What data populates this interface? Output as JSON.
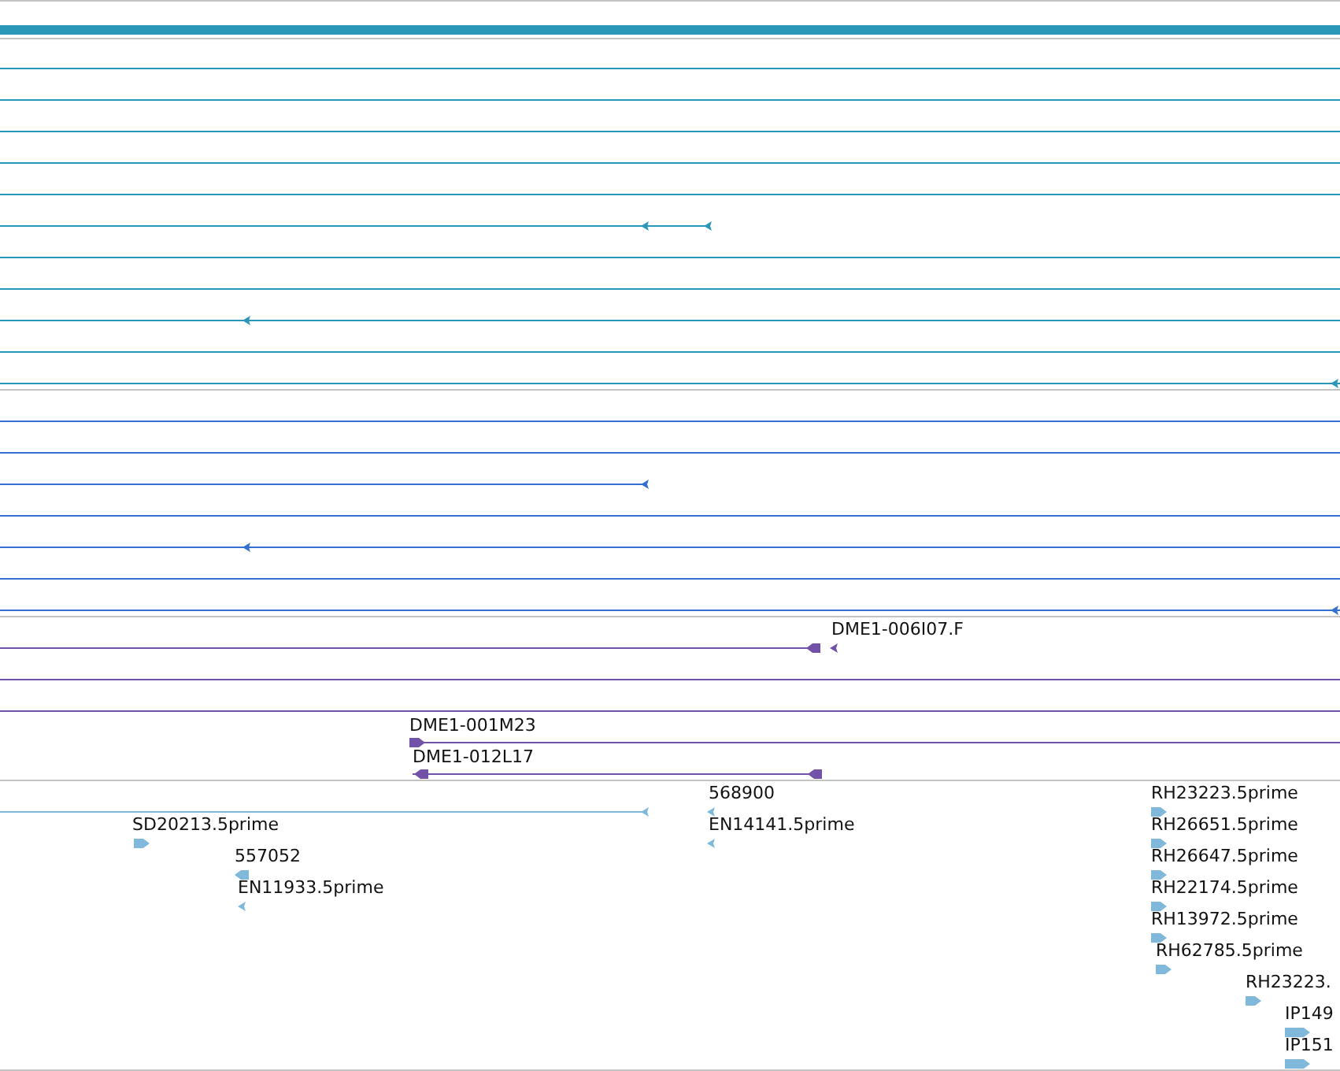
{
  "tracks": [
    {
      "color": "#2a96b8"
    },
    {
      "color": "#3470d0"
    },
    {
      "color": "#7252a8",
      "labels": [
        "DME1-006I07.F",
        "DME1-001M23",
        "DME1-012L17"
      ]
    },
    {
      "color": "#80b8dc",
      "labels": [
        "568900",
        "SD20213.5prime",
        "EN14141.5prime",
        "557052",
        "EN11933.5prime",
        "RH23223.5prime",
        "RH26651.5prime",
        "RH26647.5prime",
        "RH22174.5prime",
        "RH13972.5prime",
        "RH62785.5prime",
        "RH23223.",
        "IP149",
        "IP151"
      ]
    }
  ]
}
